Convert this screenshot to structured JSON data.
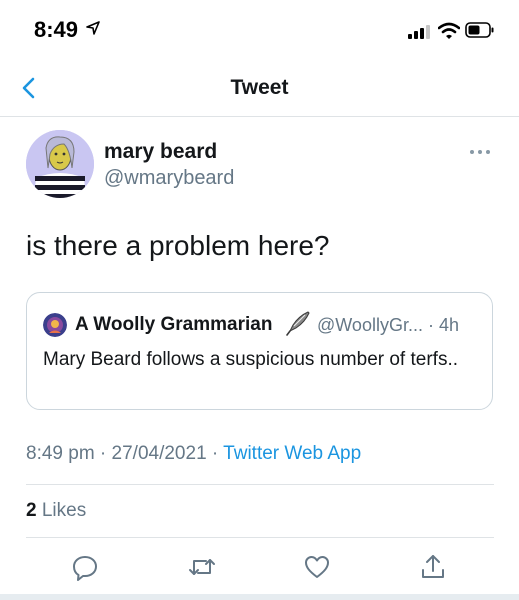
{
  "status_bar": {
    "time": "8:49"
  },
  "nav": {
    "title": "Tweet"
  },
  "tweet": {
    "display_name": "mary beard",
    "handle": "@wmarybeard",
    "text": "is there a problem here?",
    "timestamp": "8:49 pm · 27/04/2021 · ",
    "source": "Twitter Web App"
  },
  "quoted_tweet": {
    "display_name": "A Woolly Grammarian",
    "handle_time": "@WoollyGr... · 4h",
    "text": "Mary Beard follows a suspicious number of terfs.."
  },
  "stats": {
    "likes_count": "2",
    "likes_label": " Likes"
  },
  "colors": {
    "accent": "#1b95e0",
    "secondary_text": "#657786",
    "border": "#dfe3e6"
  },
  "icons": {
    "back": "chevron-left-icon",
    "more": "more-icon",
    "reply": "reply-icon",
    "retweet": "retweet-icon",
    "like": "heart-icon",
    "share": "share-icon"
  }
}
